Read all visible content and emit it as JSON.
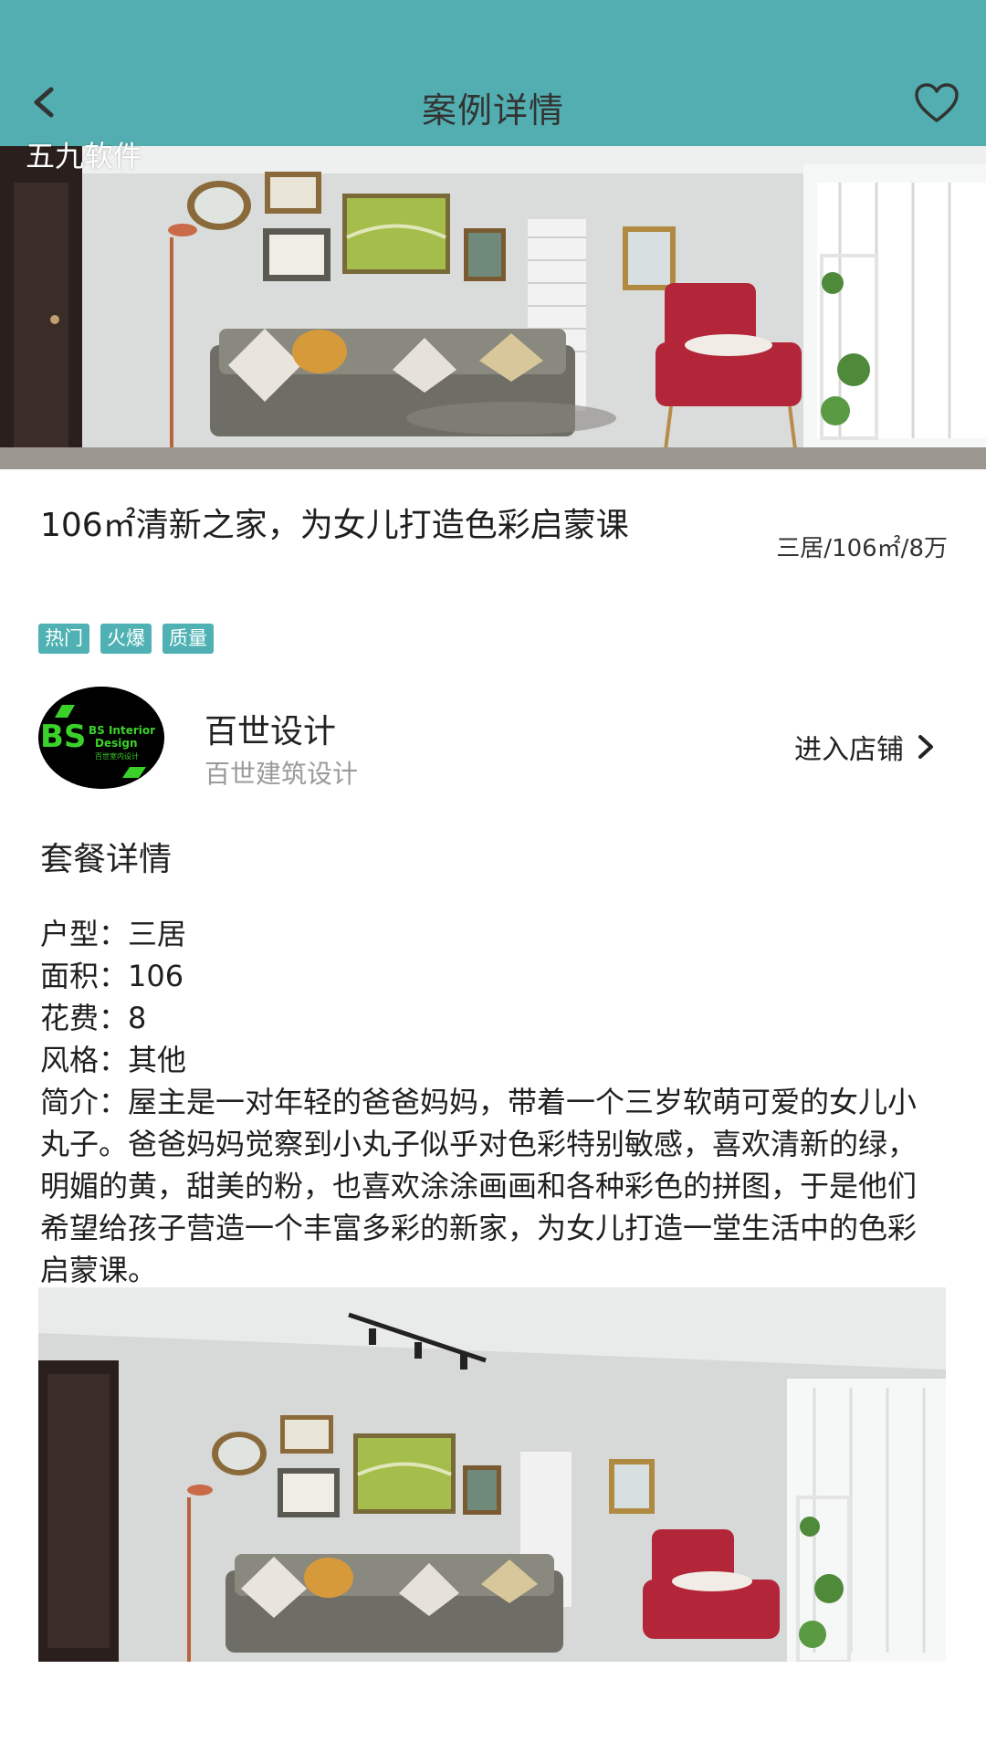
{
  "header": {
    "title": "案例详情",
    "watermark": "五九软件",
    "back_icon": "back-arrow-icon",
    "favorite_icon": "heart-outline-icon"
  },
  "case": {
    "title": "106㎡清新之家，为女儿打造色彩启蒙课",
    "meta": "三居/106㎡/8万",
    "tags": [
      "热门",
      "火爆",
      "质量"
    ]
  },
  "shop": {
    "name": "百世设计",
    "subtitle": "百世建筑设计",
    "enter_label": "进入店铺",
    "logo_text_main": "BS",
    "logo_text_line1": "BS Interior",
    "logo_text_line2": "Design",
    "logo_text_line3": "百世室内设计"
  },
  "package": {
    "section_title": "套餐详情",
    "lines": [
      "户型：三居",
      "面积：106",
      "花费：8",
      "风格：其他",
      "简介：屋主是一对年轻的爸爸妈妈，带着一个三岁软萌可爱的女儿小丸子。爸爸妈妈觉察到小丸子似乎对色彩特别敏感，喜欢清新的绿，明媚的黄，甜美的粉，也喜欢涂涂画画和各种彩色的拼图，于是他们希望给孩子营造一个丰富多彩的新家，为女儿打造一堂生活中的色彩启蒙课。"
    ]
  },
  "colors": {
    "header_bg": "#52aeb0",
    "tag_bg": "#4fb1b3",
    "sofa_red": "#b3263a",
    "logo_green": "#3bd12b"
  }
}
